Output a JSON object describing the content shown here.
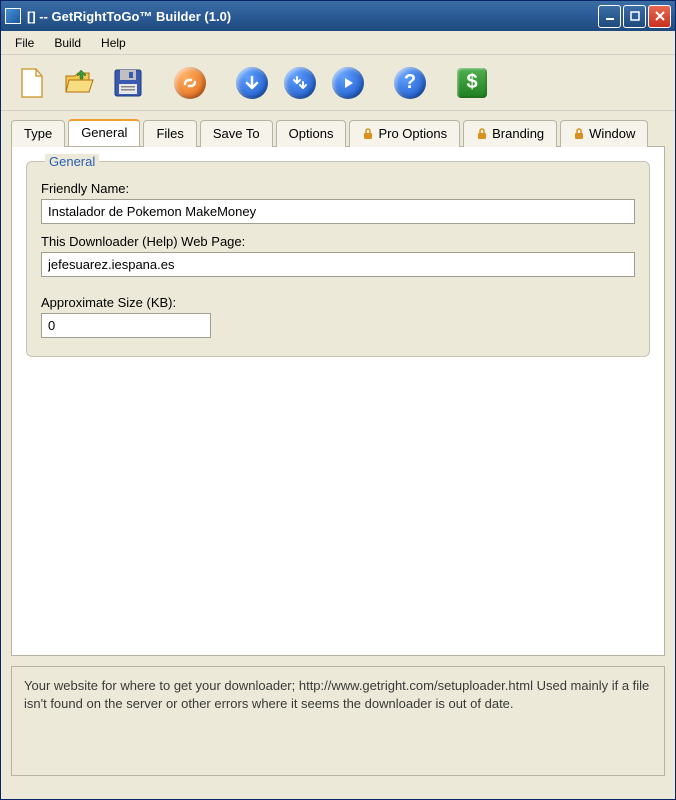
{
  "window": {
    "title": "[] -- GetRightToGo™ Builder (1.0)"
  },
  "menu": {
    "file": "File",
    "build": "Build",
    "help": "Help"
  },
  "tabs": {
    "type": "Type",
    "general": "General",
    "files": "Files",
    "saveto": "Save To",
    "options": "Options",
    "prooptions": "Pro Options",
    "branding": "Branding",
    "windowtab": "Window"
  },
  "general": {
    "legend": "General",
    "friendly_name_label": "Friendly Name:",
    "friendly_name_value": "Instalador de Pokemon MakeMoney",
    "webpage_label": "This Downloader (Help) Web Page:",
    "webpage_value": "jefesuarez.iespana.es",
    "size_label": "Approximate Size (KB):",
    "size_value": "0"
  },
  "status": {
    "text": "Your website for where to get your downloader; http://www.getright.com/setuploader.html  Used mainly if a file isn't found on the server or other errors where it seems the downloader is out of date."
  }
}
